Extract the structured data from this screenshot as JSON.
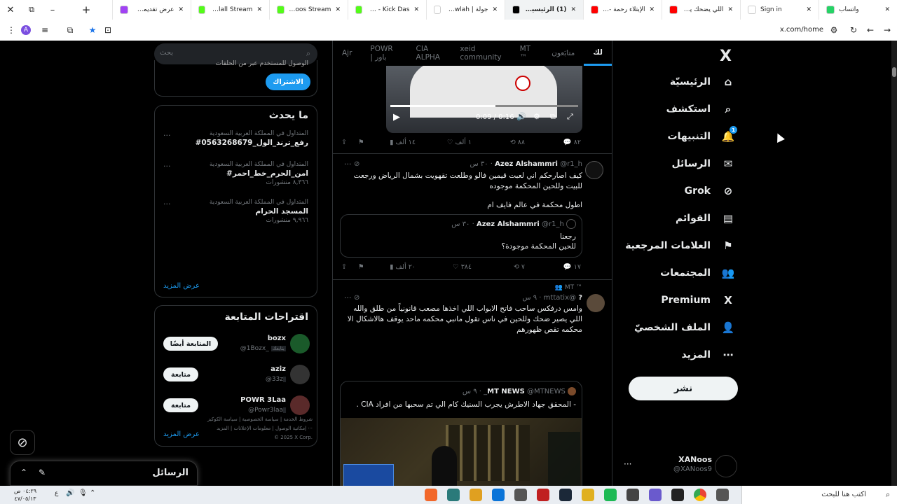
{
  "browser_tabs": [
    {
      "title": "واتساب",
      "color": "#25d366"
    },
    {
      "title": "Sign in",
      "color": "#ffffff"
    },
    {
      "title": "اللي يضحك يدفع",
      "color": "#ff0000"
    },
    {
      "title": "الإبتلاء رحمة - obe",
      "color": "#ff0000"
    },
    {
      "title": "(1) الرئيسية / X",
      "color": "#000000",
      "active": true
    },
    {
      "title": "جولة | Jawlah - ما",
      "color": "#ffffff"
    },
    {
      "title": "Stream - Kick Das",
      "color": "#53fc18"
    },
    {
      "title": "XANoos Stream",
      "color": "#53fc18"
    },
    {
      "title": "BinTalall Stream",
      "color": "#53fc18"
    },
    {
      "title": "عرض تقديمي بلا",
      "color": "#a142f4"
    }
  ],
  "address_bar": {
    "url": "x.com/home",
    "profile_letter": "A"
  },
  "nav": {
    "logo": "X",
    "items": [
      {
        "label": "الرئيسيّة",
        "icon": "⌂",
        "name": "home"
      },
      {
        "label": "استكشف",
        "icon": "⌕",
        "name": "explore"
      },
      {
        "label": "التنبيهات",
        "icon": "🔔",
        "name": "notifications",
        "badge": "1"
      },
      {
        "label": "الرسائل",
        "icon": "✉",
        "name": "messages"
      },
      {
        "label": "Grok",
        "icon": "⊘",
        "name": "grok"
      },
      {
        "label": "القوائم",
        "icon": "▤",
        "name": "lists"
      },
      {
        "label": "العلامات المرجعية",
        "icon": "⚑",
        "name": "bookmarks"
      },
      {
        "label": "المجتمعات",
        "icon": "👥",
        "name": "communities"
      },
      {
        "label": "Premium",
        "icon": "X",
        "name": "premium"
      },
      {
        "label": "الملف الشخصيّ",
        "icon": "👤",
        "name": "profile"
      },
      {
        "label": "المزيد",
        "icon": "⋯",
        "name": "more"
      }
    ],
    "post_button": "نشر",
    "profile_name": "XANoos",
    "profile_handle": "@XANoos9",
    "profile_dots": "···"
  },
  "timeline_tabs": [
    "لك",
    "متابَعون",
    "MT ™",
    "xeid community",
    "CIA ALPHA",
    "POWR | باور",
    "Ajr"
  ],
  "tweets": {
    "video": {
      "time": "0:09 / 0:16",
      "replies": "٨٢",
      "reposts": "٨٨",
      "likes": "١ ألف",
      "views": "١٤ ألف"
    },
    "t1": {
      "name": "Azez Alshammri",
      "handle": "@r1_h",
      "time": "٣٠ س",
      "text1": "كيف اصارحكم اني لعبت قيمين فالو وطلعت تقهويت بشمال الرياض ورجعت للبيت وللحين المحكمة موجوده",
      "text2": "اطول محكمة في عالم فايف ام",
      "quote_name": "Azez Alshammri",
      "quote_handle": "@r1_h",
      "quote_time": "٣٠ س",
      "quote_text1": "رجعنا",
      "quote_text2": "للحين المحكمة موجودة؟",
      "replies": "١٧",
      "reposts": "٧",
      "likes": "٣٨٤",
      "views": "٢٠ ألف"
    },
    "t2": {
      "community": "MT ™",
      "name": "?",
      "handle": "@mttatix",
      "time": "٩ س",
      "text": "وامس درفكس ساحب فاتح الابواب اللي اخذها مصعب قانونياً من طلق والله اللي يصير ضحك وللحين في ناس تقول مانبي محكمه ماحد يوقف هالاشكال الا محكمه تقص ظهورهم",
      "quote_name": "MT NEWS",
      "quote_handle": "@MTNEWS_",
      "quote_time": "٩ س",
      "quote_text": "- المحقق جهاد الاطرش يجرب السنيك كام الي تم سحبها من افراد CIA ."
    }
  },
  "sidebar": {
    "search_placeholder": "بحث",
    "subscribe_button": "الاشتراك",
    "subscribe_text": "الوصول للمستخدم عبر من الحلقات",
    "whats_happening": "ما يحدث",
    "trends": [
      {
        "context": "المتداول في المملكة العربية السعودية",
        "title": "#رفع_ترند_الول_0563268679",
        "count": ""
      },
      {
        "context": "المتداول في المملكة العربية السعودية",
        "title": "#امن_الحرم_خط_احمر",
        "count": "٨,٣٦٦ منشورات"
      },
      {
        "context": "المتداول في المملكة العربية السعودية",
        "title": "المسجد الحرام",
        "count": "٩,٩٦٦ منشورات"
      }
    ],
    "show_more": "عرض المزيد",
    "who_to_follow": "اقتراحات المتابعة",
    "follows": [
      {
        "name": "bozx",
        "handle": "@1Bozx_",
        "button": "المتابعة أيضًا",
        "tag": "يتابعك"
      },
      {
        "name": "aziz",
        "handle": "@33z",
        "button": "متابعة",
        "tag": ""
      },
      {
        "name": "POWR 3Laa",
        "handle": "@Powr3laa",
        "button": "متابعة",
        "tag": ""
      }
    ],
    "show_more_2": "عرض المزيد",
    "footer": [
      "شروط الخدمة",
      "سياسة الخصوصية",
      "سياسة الكوكيز",
      "إمكانية الوصول",
      "معلومات الإعلانات",
      "المزيد ···",
      "© 2025 X Corp."
    ]
  },
  "messages_drawer": {
    "title": "الرسائل"
  },
  "taskbar": {
    "search_placeholder": "اكتب هنا للبحث",
    "time": "٠٤:٢٩ ص",
    "date": "٤٧/٠٥/١٣",
    "lang": "ع"
  }
}
